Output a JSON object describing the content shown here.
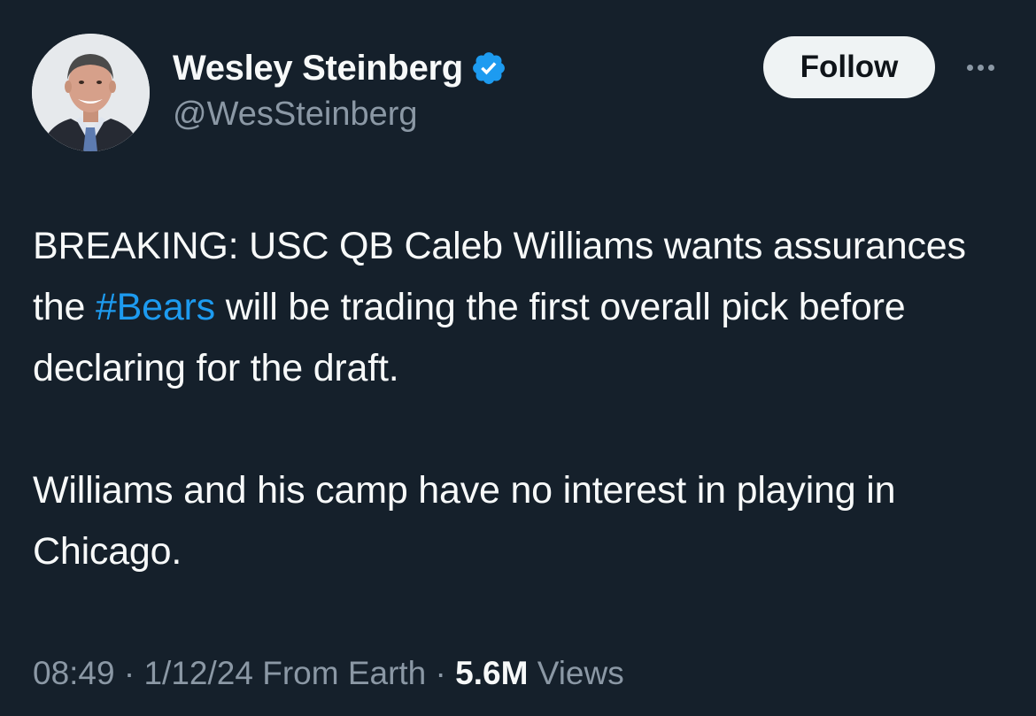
{
  "author": {
    "display_name": "Wesley Steinberg",
    "handle": "@WesSteinberg",
    "verified": true,
    "avatar_icon": "avatar-photo"
  },
  "actions": {
    "follow_label": "Follow",
    "more_icon": "more-horizontal-icon"
  },
  "tweet": {
    "paragraph1": {
      "before": "BREAKING: USC QB Caleb Williams wants assurances the ",
      "hashtag": "#Bears",
      "after": " will be trading the first overall pick before declaring for the draft."
    },
    "paragraph2": "Williams and his camp have no interest in playing in Chicago."
  },
  "meta": {
    "time": "08:49",
    "separator": " · ",
    "date": "1/12/24",
    "source": "From Earth",
    "views_count": "5.6M",
    "views_label": "Views"
  },
  "colors": {
    "background": "#15202b",
    "text": "#f7f9f9",
    "secondary_text": "#8b98a5",
    "link": "#1d9bf0",
    "verified_badge": "#1d9bf0",
    "follow_button_bg": "#eff3f4"
  }
}
